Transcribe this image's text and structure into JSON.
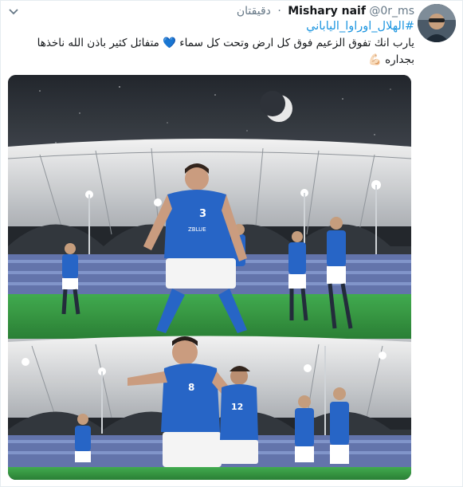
{
  "tweet": {
    "author_name": "Mishary naif",
    "author_handle": "@0r_ms",
    "separator": "·",
    "timestamp": "دقيقتان",
    "hashtag": "#الهلال_اوراوا_الياباني",
    "text_line1": "يارب انك تفوق الزعيم فوق كل ارض وتحت كل سماء 💙 متفائل كثير باذن الله ناخذها",
    "text_line2": "بجداره 💪🏻"
  },
  "photo": {
    "jersey_top_number": "3",
    "jersey_top_sponsor": "ZBLUE",
    "jersey_bottom_number": "8",
    "jersey_bottom_number2": "12"
  },
  "icons": {
    "chevron": "chevron-down-icon",
    "heart": "blue-heart-emoji",
    "flex": "flexed-biceps-emoji"
  },
  "colors": {
    "link": "#1b95e0",
    "muted": "#657786",
    "jersey": "#1f5fc4",
    "pitch": "#2c9b3a"
  }
}
